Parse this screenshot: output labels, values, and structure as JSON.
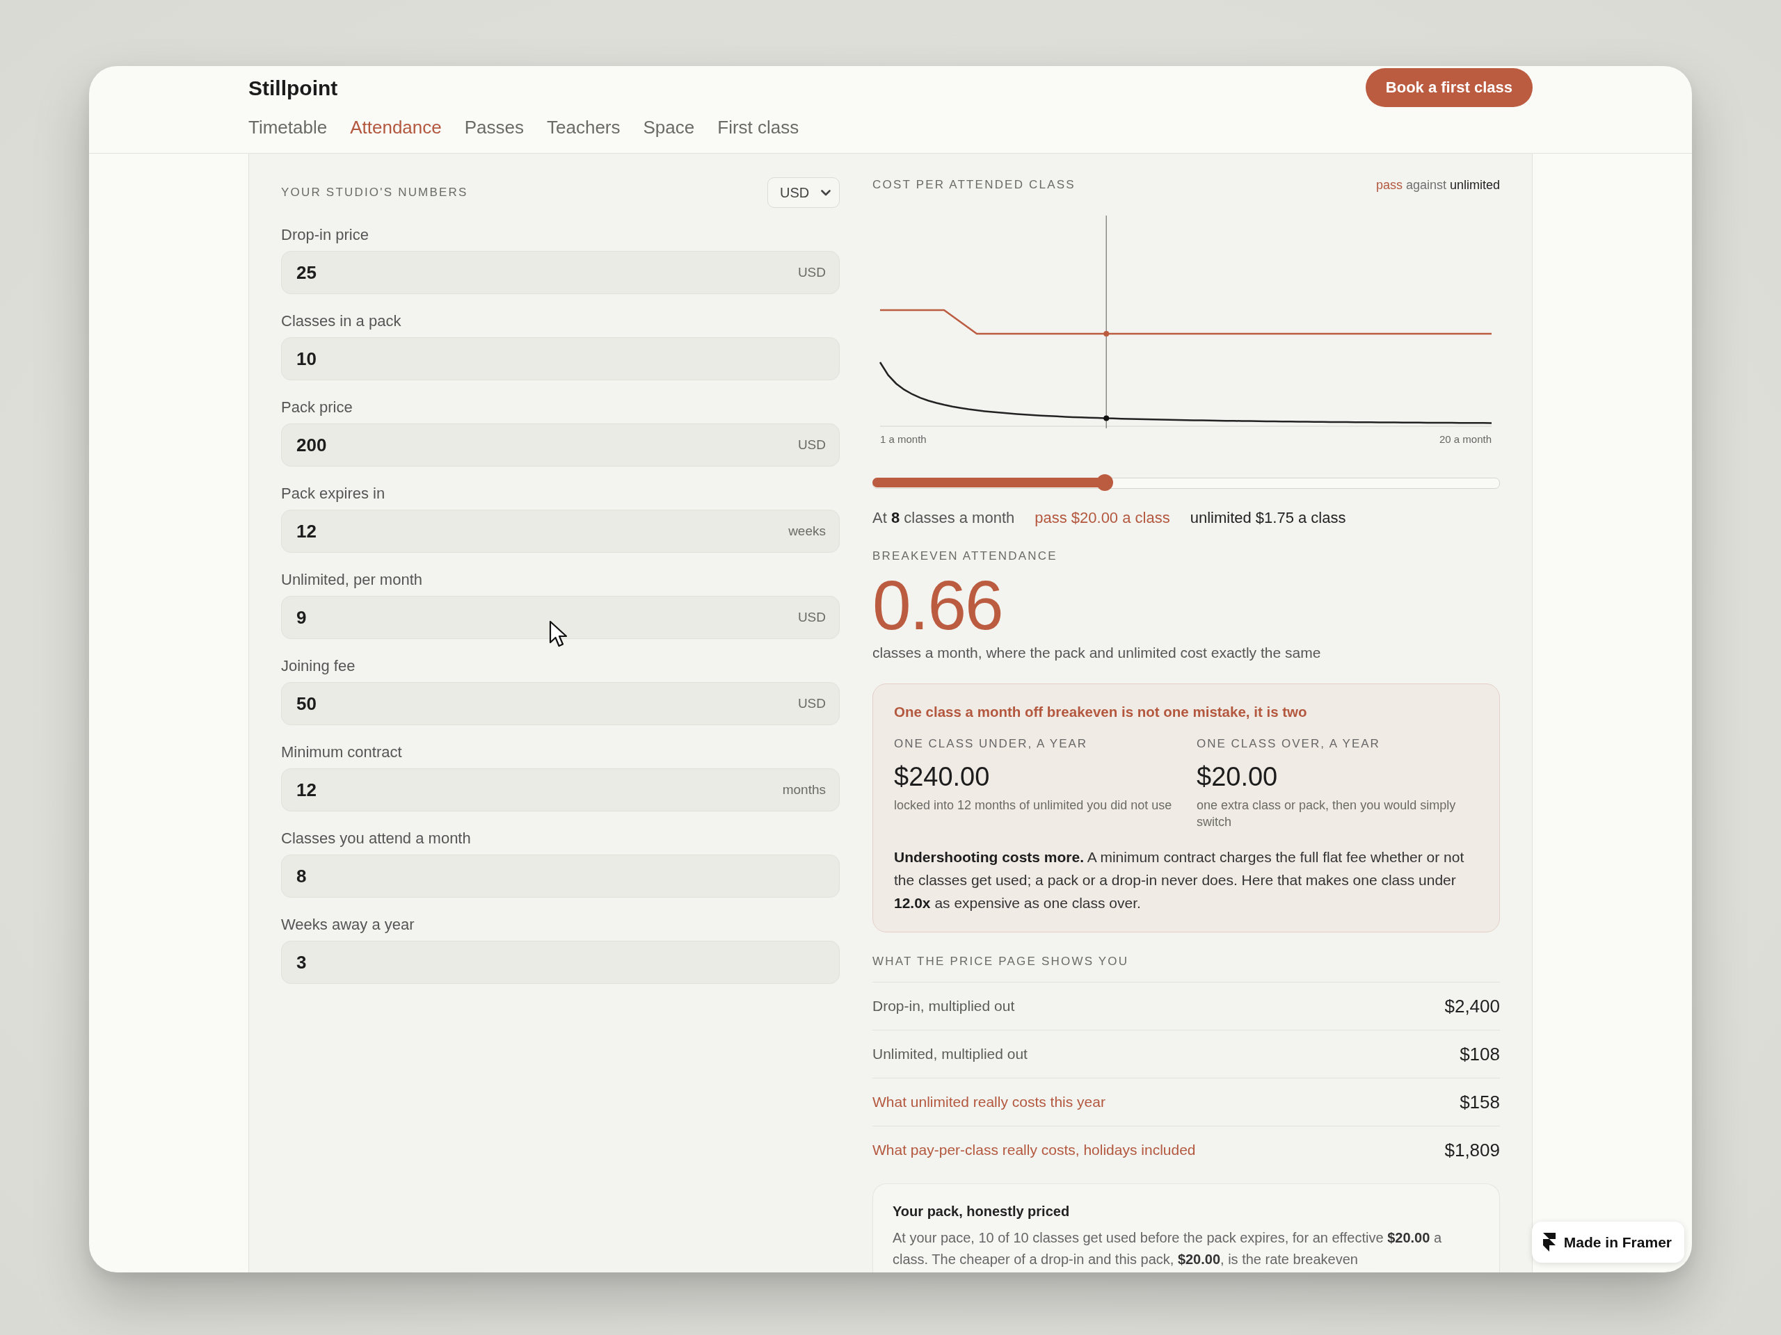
{
  "brand": "Stillpoint",
  "nav": [
    {
      "label": "Timetable",
      "selected": false
    },
    {
      "label": "Attendance",
      "selected": true
    },
    {
      "label": "Passes",
      "selected": false
    },
    {
      "label": "Teachers",
      "selected": false
    },
    {
      "label": "Space",
      "selected": false
    },
    {
      "label": "First class",
      "selected": false
    }
  ],
  "cta": "Book a first class",
  "studio": {
    "heading": "YOUR STUDIO'S NUMBERS",
    "currency": "USD",
    "fields": [
      {
        "label": "Drop-in price",
        "value": "25",
        "unit": "USD"
      },
      {
        "label": "Classes in a pack",
        "value": "10"
      },
      {
        "label": "Pack price",
        "value": "200",
        "unit": "USD"
      },
      {
        "label": "Pack expires in",
        "value": "12",
        "unit": "weeks"
      },
      {
        "label": "Unlimited, per month",
        "value": "9",
        "unit": "USD"
      },
      {
        "label": "Joining fee",
        "value": "50",
        "unit": "USD"
      },
      {
        "label": "Minimum contract",
        "value": "12",
        "unit": "months"
      },
      {
        "label": "Classes you attend a month",
        "value": "8"
      },
      {
        "label": "Weeks away a year",
        "value": "3"
      }
    ]
  },
  "cost_chart": {
    "heading": "COST PER ATTENDED CLASS",
    "legend": {
      "pass": "pass",
      "joiner": "against",
      "unlimited": "unlimited"
    },
    "x_start": "1 a month",
    "x_end": "20 a month",
    "slider": {
      "level": 0.37
    },
    "readout": {
      "attendance": "At **8** classes a month",
      "pass": "pass $20.00 a class",
      "unlimited": "unlimited $1.75 a class"
    }
  },
  "breakeven": {
    "heading": "BREAKEVEN ATTENDANCE",
    "value": "0.66",
    "caption": "classes a month, where the pack and unlimited cost exactly the same"
  },
  "mistake_card": {
    "title": "One class a month off breakeven is not one mistake, it is two",
    "columns": [
      {
        "heading": "ONE CLASS UNDER, A YEAR",
        "amount": "$240.00",
        "note": "locked into 12 months of unlimited you did not use"
      },
      {
        "heading": "ONE CLASS OVER, A YEAR",
        "amount": "$20.00",
        "note": "one extra class or pack, then you would simply switch"
      }
    ],
    "body": "**Undershooting costs more.** A minimum contract charges the full flat fee whether or not the classes get used; a pack or a drop-in never does. Here that makes one class under **12.0x** as expensive as one class over."
  },
  "price_page": {
    "heading": "WHAT THE PRICE PAGE SHOWS YOU",
    "rows": [
      {
        "label": "Drop-in, multiplied out",
        "value": "$2,400",
        "emphasis": false
      },
      {
        "label": "Unlimited, multiplied out",
        "value": "$108",
        "emphasis": false
      },
      {
        "label": "What unlimited really costs this year",
        "value": "$158",
        "emphasis": true
      },
      {
        "label": "What pay-per-class really costs, holidays included",
        "value": "$1,809",
        "emphasis": true
      }
    ]
  },
  "pack_card": {
    "title": "Your pack, honestly priced",
    "body": "At your pace, 10 of 10 classes get used before the pack expires, for an effective **$20.00** a class. The cheaper of a drop-in and this pack, **$20.00**, is the rate breakeven"
  },
  "badge": "Made in Framer"
}
